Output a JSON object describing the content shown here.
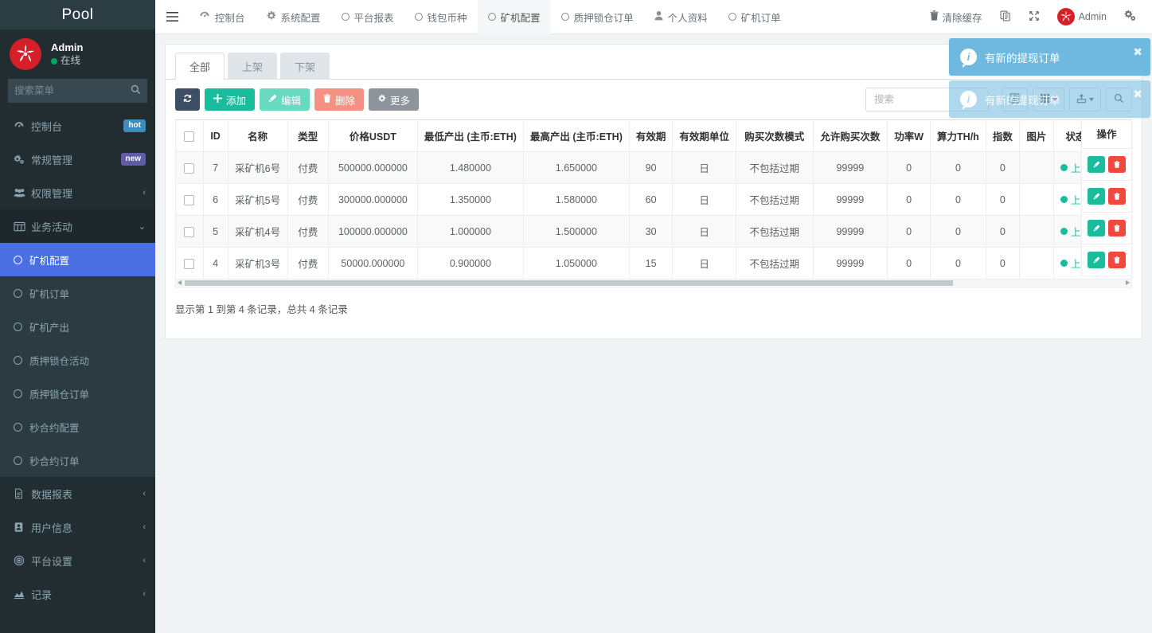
{
  "sidebar": {
    "brand": "Pool",
    "user": {
      "name": "Admin",
      "status": "在线"
    },
    "search_placeholder": "搜索菜单",
    "items": [
      {
        "label": "控制台",
        "icon": "dashboard-icon",
        "badge": "hot",
        "badge_type": "hot"
      },
      {
        "label": "常规管理",
        "icon": "gears-icon",
        "badge": "new",
        "badge_type": "new"
      },
      {
        "label": "权限管理",
        "icon": "users-icon",
        "caret": "‹"
      },
      {
        "label": "业务活动",
        "icon": "window-icon",
        "caret": "⌄"
      },
      {
        "label": "数据报表",
        "icon": "file-icon",
        "caret": "‹"
      },
      {
        "label": "用户信息",
        "icon": "id-card-icon",
        "caret": "‹"
      },
      {
        "label": "平台设置",
        "icon": "target-icon",
        "caret": "‹"
      },
      {
        "label": "记录",
        "icon": "chart-icon",
        "caret": "‹"
      }
    ],
    "submenu": [
      {
        "label": "矿机配置",
        "active": true
      },
      {
        "label": "矿机订单",
        "active": false
      },
      {
        "label": "矿机产出",
        "active": false
      },
      {
        "label": "质押锁仓活动",
        "active": false
      },
      {
        "label": "质押锁仓订单",
        "active": false
      },
      {
        "label": "秒合约配置",
        "active": false
      },
      {
        "label": "秒合约订单",
        "active": false
      }
    ]
  },
  "topnav": {
    "menu_icon": "hamburger-icon",
    "tabs": [
      {
        "label": "控制台",
        "icon": "dashboard-icon",
        "active": false
      },
      {
        "label": "系统配置",
        "icon": "gear-icon",
        "active": false
      },
      {
        "label": "平台报表",
        "icon": "circle-icon",
        "active": false
      },
      {
        "label": "钱包币种",
        "icon": "circle-icon",
        "active": false
      },
      {
        "label": "矿机配置",
        "icon": "circle-icon",
        "active": true
      },
      {
        "label": "质押锁仓订单",
        "icon": "circle-icon",
        "active": false
      },
      {
        "label": "个人资料",
        "icon": "user-icon",
        "active": false
      },
      {
        "label": "矿机订单",
        "icon": "circle-icon",
        "active": false
      }
    ],
    "right": {
      "clear_cache": "清除缓存",
      "clear_cache_icon": "trash-icon",
      "copy_icon": "copy-icon",
      "fullscreen_icon": "expand-icon",
      "username": "Admin",
      "settings_icon": "gears-icon"
    }
  },
  "toasts": [
    {
      "text": "有新的提现订单",
      "icon": "info-icon",
      "close": "✖"
    },
    {
      "text": "有新的提现订单",
      "icon": "info-icon",
      "close": "✖"
    }
  ],
  "panel": {
    "tabs": [
      {
        "label": "全部",
        "active": true
      },
      {
        "label": "上架",
        "active": false
      },
      {
        "label": "下架",
        "active": false
      }
    ],
    "toolbar": {
      "refresh_icon": "refresh-icon",
      "add_label": "添加",
      "add_icon": "plus-icon",
      "edit_label": "编辑",
      "edit_icon": "pencil-icon",
      "delete_label": "删除",
      "delete_icon": "trash-icon",
      "more_label": "更多",
      "more_icon": "gear-icon",
      "search_placeholder": "搜索",
      "columns_icon": "list-icon",
      "grid_icon": "grid-icon",
      "export_icon": "export-icon",
      "search_icon": "search-icon"
    },
    "table": {
      "columns": [
        "ID",
        "名称",
        "类型",
        "价格USDT",
        "最低产出 (主币:ETH)",
        "最高产出 (主币:ETH)",
        "有效期",
        "有效期单位",
        "购买次数模式",
        "允许购买次数",
        "功率W",
        "算力TH/h",
        "指数",
        "图片",
        "状态"
      ],
      "action_column": "操作",
      "rows": [
        {
          "id": "7",
          "name": "采矿机6号",
          "type": "付费",
          "price": "500000.000000",
          "min_out": "1.480000",
          "max_out": "1.650000",
          "validity": "90",
          "unit": "日",
          "buy_mode": "不包括过期",
          "buy_count": "99999",
          "power": "0",
          "hashrate": "0",
          "index": "0",
          "image": "",
          "status": "上架"
        },
        {
          "id": "6",
          "name": "采矿机5号",
          "type": "付费",
          "price": "300000.000000",
          "min_out": "1.350000",
          "max_out": "1.580000",
          "validity": "60",
          "unit": "日",
          "buy_mode": "不包括过期",
          "buy_count": "99999",
          "power": "0",
          "hashrate": "0",
          "index": "0",
          "image": "",
          "status": "上架"
        },
        {
          "id": "5",
          "name": "采矿机4号",
          "type": "付费",
          "price": "100000.000000",
          "min_out": "1.000000",
          "max_out": "1.500000",
          "validity": "30",
          "unit": "日",
          "buy_mode": "不包括过期",
          "buy_count": "99999",
          "power": "0",
          "hashrate": "0",
          "index": "0",
          "image": "",
          "status": "上架"
        },
        {
          "id": "4",
          "name": "采矿机3号",
          "type": "付费",
          "price": "50000.000000",
          "min_out": "0.900000",
          "max_out": "1.050000",
          "validity": "15",
          "unit": "日",
          "buy_mode": "不包括过期",
          "buy_count": "99999",
          "power": "0",
          "hashrate": "0",
          "index": "0",
          "image": "",
          "status": "上架"
        }
      ],
      "footer": "显示第 1 到第 4 条记录，总共 4 条记录"
    }
  },
  "colors": {
    "sidebar_bg": "#222d32",
    "accent_active": "#4a6fe3",
    "primary_green": "#1abc9c",
    "danger_red": "#f0483e",
    "toast_blue": "#6fb9e0",
    "badge_hot": "#3c8dbc",
    "badge_new": "#605ca8",
    "avatar_red": "#d62027"
  }
}
